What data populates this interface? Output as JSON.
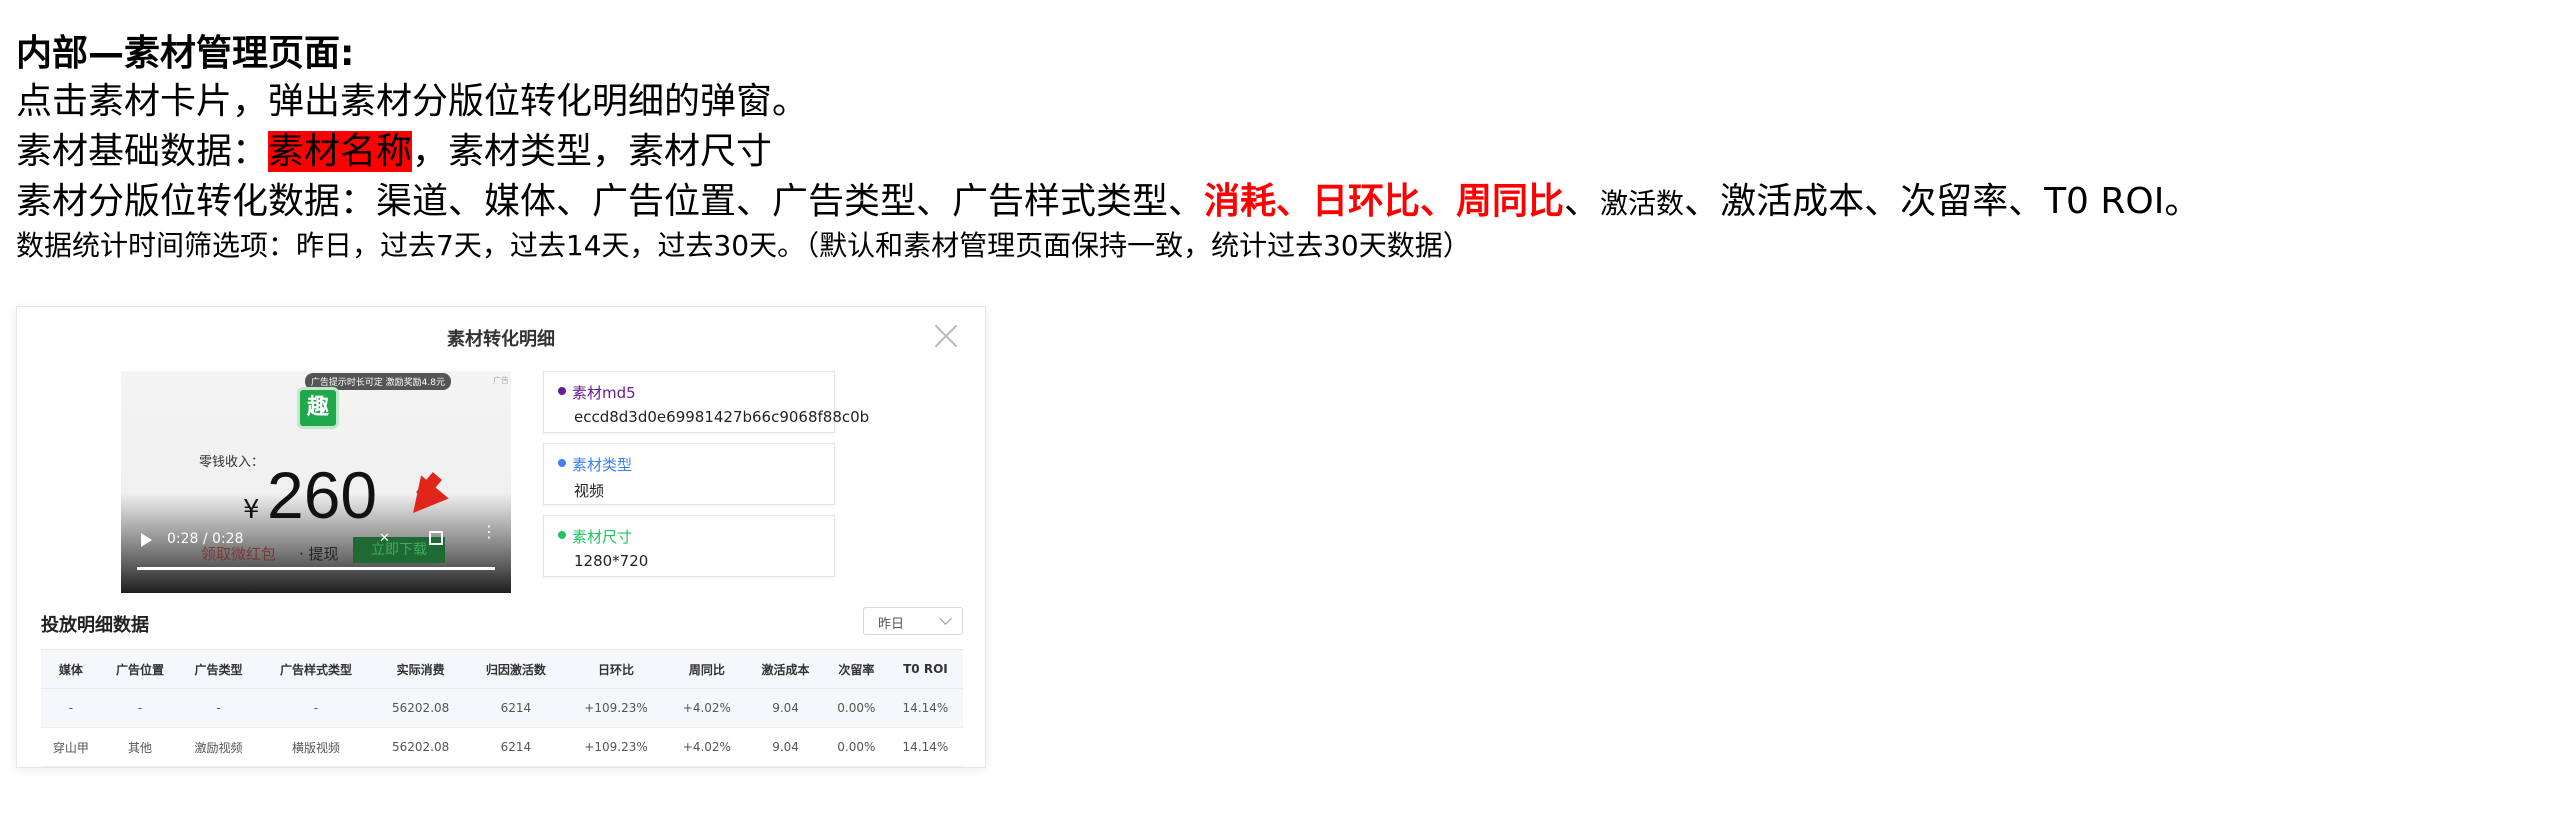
{
  "doc": {
    "line1": "内部—素材管理页面:",
    "line2": "点击素材卡片，弹出素材分版位转化明细的弹窗。",
    "line3_prefix": "素材基础数据：",
    "line3_highlight": "素材名称",
    "line3_suffix": "，素材类型，素材尺寸",
    "line4_prefix": "素材分版位转化数据：渠道、媒体、广告位置、广告类型、广告样式类型、",
    "line4_red": "消耗、日环比、周同比",
    "line4_sep": "、",
    "line4_small": "激活数",
    "line4_suffix": "、激活成本、次留率、T0 ROI。",
    "line5": "数据统计时间筛选项：昨日，过去7天，过去14天，过去30天。（默认和素材管理页面保持一致，统计过去30天数据）"
  },
  "modal": {
    "title": "素材转化明细",
    "video": {
      "badge": "广告提示时长可定 激励奖励4.8元",
      "badge2": "广告",
      "logo_char": "趣",
      "label": "零钱收入：",
      "currency": "¥",
      "amount": "260",
      "time": "0:28 / 0:28",
      "faded_button": "领取微红包",
      "withdraw": "· 提现",
      "download": "立即下载"
    },
    "info": [
      {
        "label": "素材md5",
        "value": "eccd8d3d0e69981427b66c9068f88c0b",
        "color": "#6a1b9a"
      },
      {
        "label": "素材类型",
        "value": "视频",
        "color": "#3b82f6"
      },
      {
        "label": "素材尺寸",
        "value": "1280*720",
        "color": "#22c55e"
      }
    ],
    "section_title": "投放明细数据",
    "filter_value": "昨日",
    "table": {
      "headers": [
        "媒体",
        "广告位置",
        "广告类型",
        "广告样式类型",
        "实际消费",
        "归因激活数",
        "日环比",
        "周同比",
        "激活成本",
        "次留率",
        "T0 ROI"
      ],
      "rows": [
        [
          "-",
          "-",
          "-",
          "-",
          "56202.08",
          "6214",
          "+109.23%",
          "+4.02%",
          "9.04",
          "0.00%",
          "14.14%"
        ],
        [
          "穿山甲",
          "其他",
          "激励视频",
          "横版视频",
          "56202.08",
          "6214",
          "+109.23%",
          "+4.02%",
          "9.04",
          "0.00%",
          "14.14%"
        ]
      ]
    }
  }
}
